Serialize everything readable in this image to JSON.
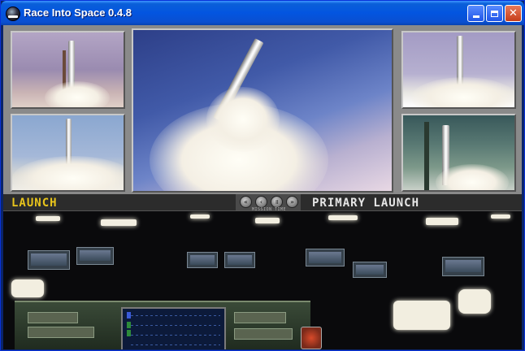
{
  "window": {
    "title": "Race Into Space 0.4.8",
    "app_icon": "app-icon",
    "controls": [
      "minimize-icon",
      "maximize-icon",
      "close-icon"
    ],
    "close_glyph": "✕"
  },
  "launch_view": {
    "left_label": "LAUNCH",
    "right_label": "PRIMARY LAUNCH",
    "mission_time_label": "MISSION TIME",
    "playback_controls": [
      "rewind-icon",
      "back-icon",
      "pause-icon",
      "forward-icon"
    ]
  },
  "colors": {
    "title_bar": "#0355e0",
    "launch_label": "#e8c41c",
    "primary_label": "#e6e6e6",
    "panel_frame": "#8a8a8a"
  }
}
